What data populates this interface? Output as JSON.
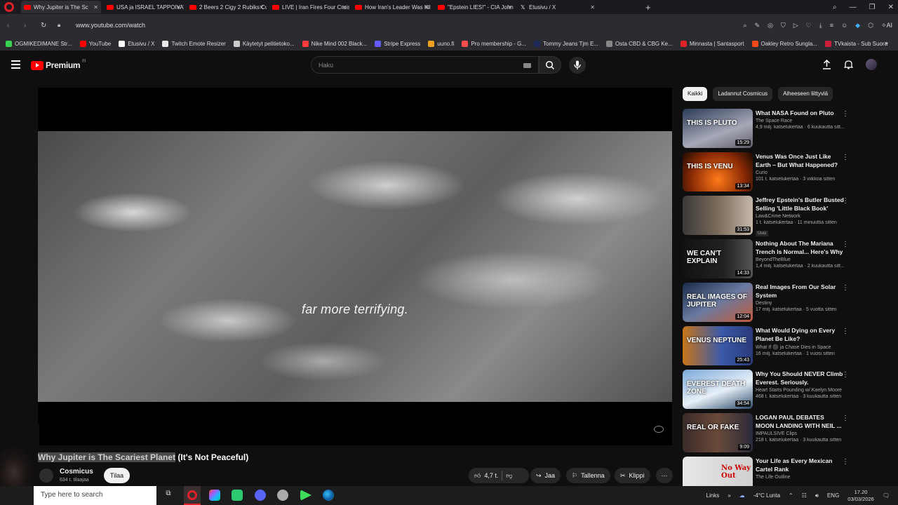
{
  "browser": {
    "tabs": [
      {
        "title": "Why Jupiter is The Sc",
        "icon": "youtube-icon",
        "active": true
      },
      {
        "title": "USA ja ISRAEL TAPPOIVAT",
        "icon": "youtube-icon"
      },
      {
        "title": "2 Beers 2 Cigy 2 Rubiks Cu",
        "icon": "youtube-icon"
      },
      {
        "title": "LIVE | Iran Fires Four Cruis",
        "icon": "youtube-icon"
      },
      {
        "title": "How Iran's Leader Was Kil",
        "icon": "youtube-icon"
      },
      {
        "title": "\"Epstein LIES!\" - CIA John",
        "icon": "youtube-icon"
      },
      {
        "title": "Etusivu / X",
        "icon": "x-icon"
      }
    ],
    "url": "www.youtube.com/watch",
    "ai_label": "AI",
    "bookmarks": [
      {
        "label": "OGMIKEDIMANE Str...",
        "color": "#39d353"
      },
      {
        "label": "YouTube",
        "color": "#ff0000"
      },
      {
        "label": "Etusivu / X",
        "color": "#ffffff"
      },
      {
        "label": "Twitch Emote Resizer",
        "color": "#e8e8e8"
      },
      {
        "label": "Käytetyt pelitietoko...",
        "color": "#cccccc"
      },
      {
        "label": "Nike Mind 002 Black...",
        "color": "#ff3b3b"
      },
      {
        "label": "Stripe Express",
        "color": "#635bff"
      },
      {
        "label": "uuno.fi",
        "color": "#f0a020"
      },
      {
        "label": "Pro membership - G...",
        "color": "#ff4d4d"
      },
      {
        "label": "Tommy Jeans Tjm E...",
        "color": "#1e2a5a"
      },
      {
        "label": "Osta CBD & CBG Ke...",
        "color": "#888888"
      },
      {
        "label": "Minnasta | Santasport",
        "color": "#e0212a"
      },
      {
        "label": "Oakley Retro Sungla...",
        "color": "#f04a1a"
      },
      {
        "label": "TVkaista - Sub Suora",
        "color": "#cc1f3a"
      }
    ]
  },
  "youtube": {
    "logo_text": "Premium",
    "logo_superscript": "FI",
    "search_placeholder": "Haku",
    "player": {
      "caption": "far more terrifying."
    },
    "video": {
      "title_highlighted": "Why Jupiter is The Scariest Planet",
      "title_rest": " (It's Not Peaceful)",
      "channel": "Cosmicus",
      "subscribers": "634 t. tilaajaa",
      "subscribe_label": "Tilaa",
      "likes": "4,7 t.",
      "share_label": "Jaa",
      "save_label": "Tallenna",
      "clip_label": "Klippi"
    },
    "chips": [
      "Kaikki",
      "Ladannut Cosmicus",
      "Aiheeseen liittyviä"
    ],
    "recommendations": [
      {
        "title": "What NASA Found on Pluto",
        "channel": "The Space Race",
        "meta": "4,9 milj. katselukertaa · 6 kuukautta sitt...",
        "duration": "15:29",
        "thumb_text": "THIS IS PLUTO",
        "thumb_bg": "linear-gradient(160deg,#2b3a55,#a7a9b8 60%,#5e5a66)"
      },
      {
        "title": "Venus Was Once Just Like Earth – But What Happened?",
        "channel": "Curio",
        "meta": "101 t. katselukertaa · 3 viikkoa sitten",
        "duration": "13:34",
        "thumb_text": "THIS IS VENU",
        "thumb_bg": "radial-gradient(circle at 50% 70%,#ff7a1a,#8a2a05 60%,#1a0a03)"
      },
      {
        "title": "Jeffrey Epstein's Butler Busted Selling 'Little Black Book'",
        "channel": "Law&Crime Network",
        "meta": "1 t. katselukertaa · 11 minuuttia sitten",
        "duration": "31:53",
        "badge": "Uusi",
        "thumb_text": "",
        "thumb_bg": "linear-gradient(90deg,#3a3a3a,#7a6a5a 50%,#c5b8a8)"
      },
      {
        "title": "Nothing About The Mariana Trench Is Normal... Here's Why",
        "channel": "BeyondTheBlue",
        "meta": "1,4 milj. katselukertaa · 2 kuukautta sitt...",
        "duration": "14:33",
        "thumb_text": "WE CAN'T EXPLAIN",
        "thumb_bg": "linear-gradient(90deg,#111,#222 60%,#555)"
      },
      {
        "title": "Real Images From Our Solar System",
        "channel": "Destiny",
        "meta": "17 milj. katselukertaa · 5 vuotta sitten",
        "duration": "12:04",
        "thumb_text": "REAL IMAGES OF JUPITER",
        "thumb_bg": "linear-gradient(150deg,#1a2a4a,#6a7aa0 50%,#c25a3a)"
      },
      {
        "title": "What Would Dying on Every Planet Be Like?",
        "channel": "What If ⚫ ja Chase Dies in Space",
        "meta": "16 milj. katselukertaa · 1 vuosi sitten",
        "duration": "25:43",
        "thumb_text": "VENUS   NEPTUNE",
        "thumb_bg": "linear-gradient(90deg,#c8751a,#3a5aa8 55%,#2a3a7a)"
      },
      {
        "title": "Why You Should NEVER Climb Everest. Seriously.",
        "channel": "Heart Starts Pounding w/ Kaelyn Moore",
        "meta": "468 t. katselukertaa · 3 kuukautta sitten",
        "duration": "34:54",
        "thumb_text": "EVEREST DEATH ZONE",
        "thumb_bg": "linear-gradient(160deg,#7aa8d8,#e8f0f8 55%,#2a4a6a)"
      },
      {
        "title": "LOGAN PAUL DEBATES MOON LANDING WITH NEIL ...",
        "channel": "IMPAULSIVE Clips",
        "meta": "218 t. katselukertaa · 3 kuukautta sitten",
        "duration": "9:09",
        "thumb_text": "REAL OR FAKE",
        "thumb_bg": "linear-gradient(90deg,#3a2a2a,#6a4a3a 50%,#2a2a3a)"
      },
      {
        "title": "Your Life as Every Mexican Cartel Rank",
        "channel": "The Life Outline",
        "meta": "",
        "duration": "",
        "thumb_text": "No Way Out",
        "thumb_bg": "linear-gradient(90deg,#e8e8e8,#cfcfcf)"
      }
    ]
  },
  "taskbar": {
    "search_placeholder": "Type here to search",
    "links_label": "Links",
    "weather": "-4°C  Lunta",
    "language": "ENG",
    "time": "17.20",
    "date": "03/03/2026"
  }
}
